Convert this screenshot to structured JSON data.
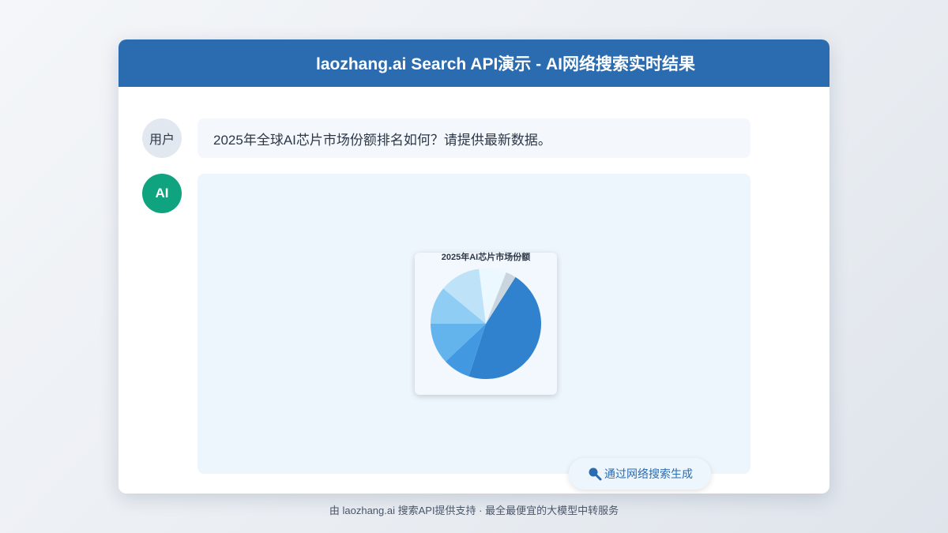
{
  "window": {
    "title": "laozhang.ai Search API演示 - AI网络搜索实时结果"
  },
  "conversation": {
    "user": {
      "avatar_label": "用户",
      "message": "2025年全球AI芯片市场份额排名如何？请提供最新数据。"
    },
    "ai": {
      "avatar_label": "AI",
      "avatar_color": "#10a37f"
    }
  },
  "chart_data": {
    "type": "pie",
    "title": "2025年AI芯片市场份额",
    "values": [
      46,
      8,
      12,
      11,
      12,
      8,
      3
    ],
    "colors": [
      "#3182ce",
      "#4299e1",
      "#63b3ed",
      "#90cdf4",
      "#bee3f8",
      "#ebf8ff",
      "#cbd5e0"
    ]
  },
  "source_badge": {
    "label": "通过网络搜索生成",
    "icon": "search-icon"
  },
  "footer": {
    "text": "由 laozhang.ai 搜索API提供支持 · 最全最便宜的大模型中转服务"
  },
  "colors": {
    "header": "#2b6cb0",
    "accent": "#2b6cb0"
  }
}
